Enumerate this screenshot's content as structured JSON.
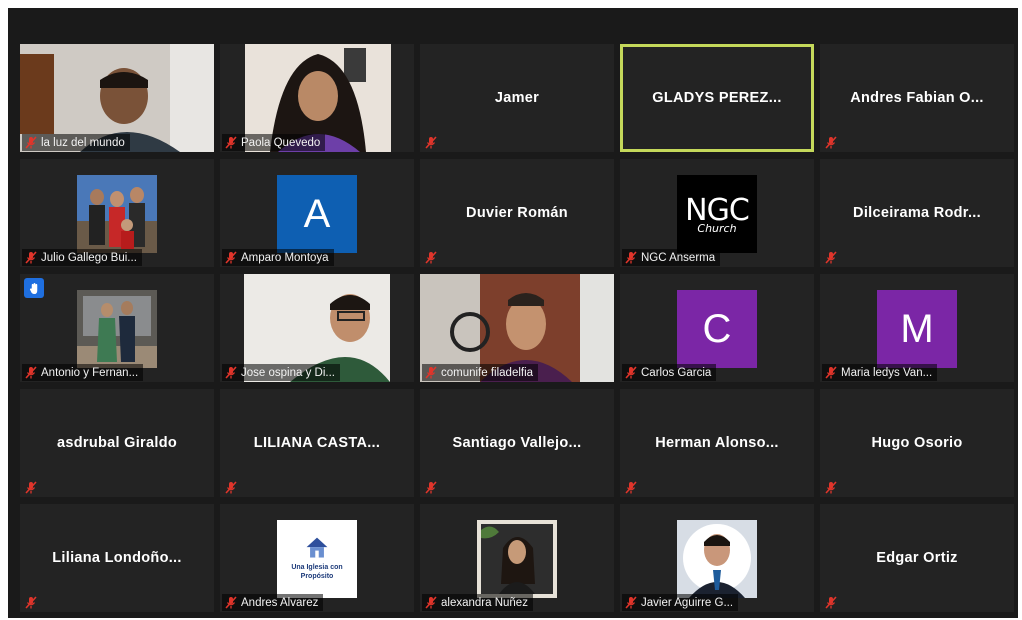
{
  "participants": [
    {
      "name": "la luz del mundo",
      "kind": "video",
      "muted": true
    },
    {
      "name": "Paola Quevedo",
      "kind": "video",
      "muted": true
    },
    {
      "name": "Jamer",
      "kind": "name",
      "muted": true
    },
    {
      "name": "GLADYS PEREZ...",
      "kind": "name",
      "muted": false,
      "speaking": true
    },
    {
      "name": "Andres Fabian O...",
      "kind": "name",
      "muted": true
    },
    {
      "name": "Julio Gallego Bui...",
      "kind": "photo",
      "muted": true
    },
    {
      "name": "Amparo Montoya",
      "kind": "letter",
      "letter": "A",
      "color": "#0e5fb2",
      "muted": true
    },
    {
      "name": "Duvier Román",
      "kind": "name",
      "muted": true
    },
    {
      "name": "NGC Anserma",
      "kind": "logo",
      "logo_text": "NGC",
      "logo_script": "Church",
      "muted": true
    },
    {
      "name": "Dilceirama Rodr...",
      "kind": "name",
      "muted": true
    },
    {
      "name": "Antonio y Fernan...",
      "kind": "photo",
      "muted": true,
      "hand_raised": true
    },
    {
      "name": "Jose ospina y Di...",
      "kind": "video",
      "muted": true
    },
    {
      "name": "comunife filadelfia",
      "kind": "video",
      "muted": true
    },
    {
      "name": "Carlos Garcia",
      "kind": "letter",
      "letter": "C",
      "color": "#7b26a6",
      "muted": true
    },
    {
      "name": "Maria ledys Van...",
      "kind": "letter",
      "letter": "M",
      "color": "#7b26a6",
      "muted": true
    },
    {
      "name": "asdrubal Giraldo",
      "kind": "name",
      "muted": true
    },
    {
      "name": "LILIANA CASTA...",
      "kind": "name",
      "muted": true
    },
    {
      "name": "Santiago Vallejo...",
      "kind": "name",
      "muted": true
    },
    {
      "name": "Herman Alonso...",
      "kind": "name",
      "muted": true
    },
    {
      "name": "Hugo Osorio",
      "kind": "name",
      "muted": true
    },
    {
      "name": "Liliana Londoño...",
      "kind": "name",
      "muted": true
    },
    {
      "name": "Andres Alvarez",
      "kind": "poster",
      "muted": true,
      "poster_lines": [
        "Una Iglesia con Propósito"
      ]
    },
    {
      "name": "alexandra Nuñez",
      "kind": "photo",
      "muted": true
    },
    {
      "name": "Javier Aguirre G...",
      "kind": "photo",
      "muted": true
    },
    {
      "name": "Edgar Ortiz",
      "kind": "name",
      "muted": true
    }
  ],
  "colors": {
    "speaking_border": "#c4d85a",
    "muted_icon": "#e0352b",
    "tile_bg": "#232323",
    "raise_hand": "#1f6fe0"
  },
  "icons": {
    "muted": "mic-muted-icon",
    "raise_hand": "raise-hand-icon"
  }
}
